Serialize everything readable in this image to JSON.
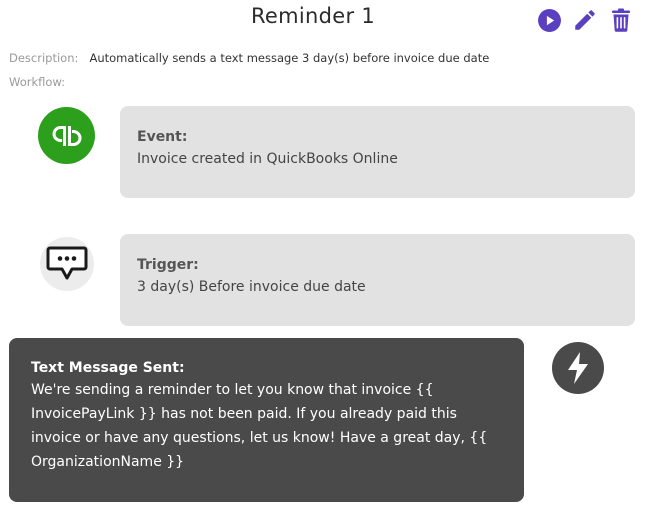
{
  "header": {
    "title": "Reminder 1",
    "actions": {
      "play_icon": "play-circle-icon",
      "edit_icon": "pencil-icon",
      "delete_icon": "trash-icon"
    }
  },
  "meta": {
    "description_label": "Description:",
    "description_value": "Automatically sends a text message 3 day(s) before invoice due date",
    "workflow_label": "Workflow:"
  },
  "workflow": {
    "event": {
      "icon": "quickbooks-logo-icon",
      "label": "Event:",
      "text": "Invoice created in QuickBooks Online"
    },
    "trigger": {
      "icon": "chat-bubble-icon",
      "label": "Trigger:",
      "text": "3 day(s) Before invoice due date"
    },
    "action": {
      "icon": "lightning-bolt-icon",
      "label": "Text Message Sent:",
      "text": "We're sending a reminder to let you know that invoice {{ InvoicePayLink }} has not been paid. If you already paid this invoice or have any questions, let us know! Have a great day, {{ OrganizationName }}"
    }
  },
  "colors": {
    "accent": "#5a3fc0",
    "quickbooks_green": "#2ca01c",
    "card_bg": "#e2e2e2",
    "message_bg": "#4a4a4a"
  }
}
